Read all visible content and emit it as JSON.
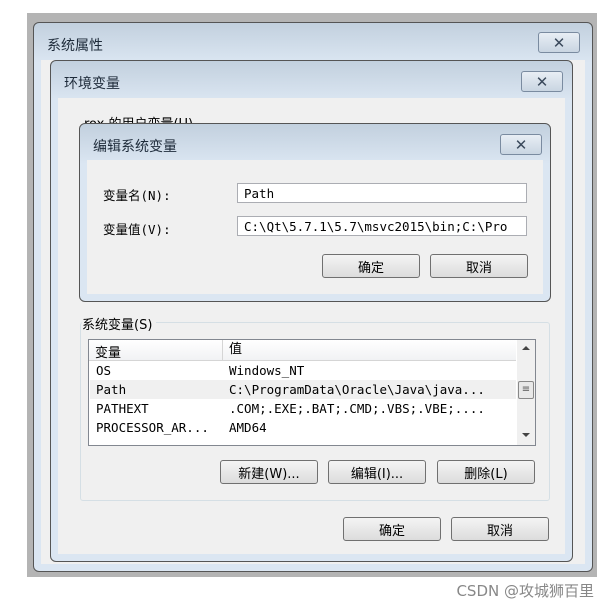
{
  "system_properties": {
    "title": "系统属性"
  },
  "env_vars": {
    "title": "环境变量",
    "user_vars_label": "rox 的用户变量(U)",
    "ok": "确定",
    "cancel": "取消"
  },
  "edit_dialog": {
    "title": "编辑系统变量",
    "name_label": "变量名(N):",
    "name_value": "Path",
    "value_label": "变量值(V):",
    "value_value": "C:\\Qt\\5.7.1\\5.7\\msvc2015\\bin;C:\\Pro",
    "ok": "确定",
    "cancel": "取消"
  },
  "system_vars": {
    "label": "系统变量(S)",
    "columns": [
      "变量",
      "值"
    ],
    "rows": [
      [
        "OS",
        "Windows_NT"
      ],
      [
        "Path",
        "C:\\ProgramData\\Oracle\\Java\\java..."
      ],
      [
        "PATHEXT",
        ".COM;.EXE;.BAT;.CMD;.VBS;.VBE;...."
      ],
      [
        "PROCESSOR_AR...",
        "AMD64"
      ]
    ],
    "new": "新建(W)...",
    "edit": "编辑(I)...",
    "delete": "删除(L)"
  },
  "close_glyph": "✕",
  "watermark": "CSDN @攻城狮百里"
}
